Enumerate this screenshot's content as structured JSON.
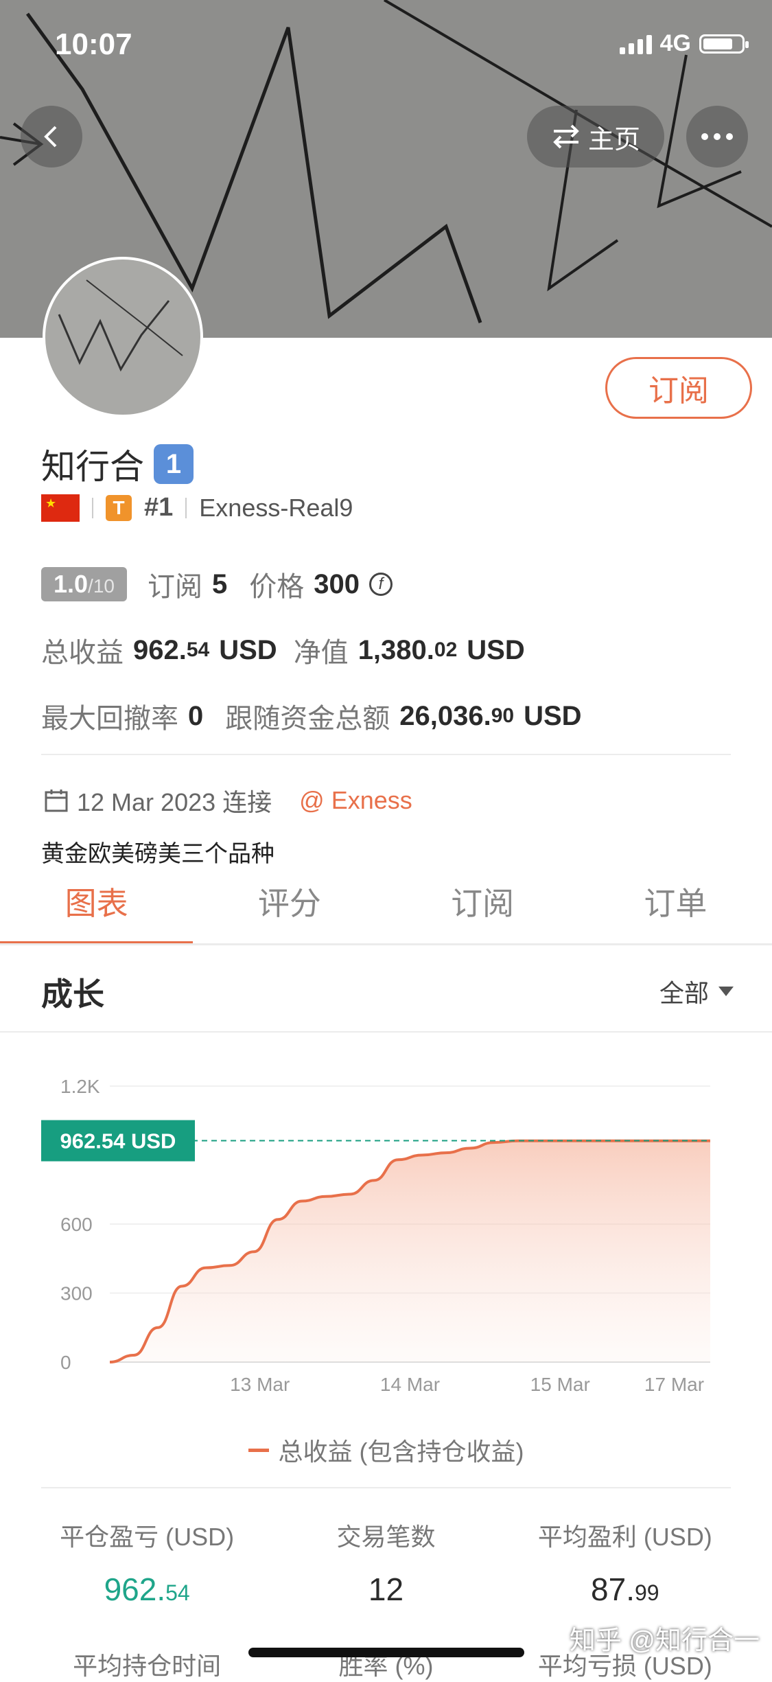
{
  "status": {
    "time": "10:07",
    "network": "4G"
  },
  "header": {
    "back_icon": "chevron-left-icon",
    "home_label": "主页",
    "home_icon": "swap-icon",
    "more_icon": "more-dots-icon"
  },
  "profile": {
    "name": "知行合",
    "badge": "1",
    "rank": "#1",
    "account": "Exness-Real9",
    "subscribe_label": "订阅",
    "score": "1.0",
    "score_max": "/10",
    "subscribe_text": "订阅",
    "subscribe_count": "5",
    "price_label": "价格",
    "price_value": "300",
    "total_profit_label": "总收益",
    "total_profit_int": "962.",
    "total_profit_dec": "54",
    "total_profit_unit": "USD",
    "equity_label": "净值",
    "equity_int": "1,380.",
    "equity_dec": "02",
    "equity_unit": "USD",
    "drawdown_label": "最大回撤率",
    "drawdown_value": "0",
    "follow_label": "跟随资金总额",
    "follow_int": "26,036.",
    "follow_dec": "90",
    "follow_unit": "USD",
    "date_text": "12 Mar 2023 连接",
    "broker": "@ Exness",
    "description": "黄金欧美磅美三个品种"
  },
  "tabs": [
    "图表",
    "评分",
    "订阅",
    "订单"
  ],
  "section": {
    "title": "成长",
    "filter": "全部"
  },
  "chart_data": {
    "type": "area",
    "ylim": [
      0,
      1200
    ],
    "yticks": [
      "0",
      "300",
      "600",
      "1.2K"
    ],
    "ytick_values": [
      0,
      300,
      600,
      1200
    ],
    "xticks": [
      "13 Mar",
      "14 Mar",
      "15 Mar",
      "17 Mar"
    ],
    "xtick_values": [
      0.25,
      0.5,
      0.75,
      0.94
    ],
    "current_label": "962.54 USD",
    "current_value": 962.54,
    "x": [
      0.0,
      0.04,
      0.08,
      0.12,
      0.16,
      0.2,
      0.24,
      0.28,
      0.32,
      0.36,
      0.4,
      0.44,
      0.48,
      0.52,
      0.56,
      0.6,
      0.64,
      0.68,
      0.72,
      0.76,
      0.8,
      0.84,
      0.88,
      0.92,
      0.96,
      1.0
    ],
    "values": [
      0,
      30,
      150,
      330,
      410,
      420,
      480,
      620,
      700,
      720,
      730,
      790,
      880,
      900,
      910,
      930,
      955,
      962,
      962,
      962,
      962,
      962,
      962,
      962,
      962,
      962
    ],
    "legend": "总收益 (包含持仓收益)",
    "color": "#e8704a"
  },
  "stats": [
    {
      "label": "平仓盈亏 (USD)",
      "int": "962.",
      "dec": "54",
      "color": "green"
    },
    {
      "label": "交易笔数",
      "int": "12",
      "dec": "",
      "color": ""
    },
    {
      "label": "平均盈利 (USD)",
      "int": "87.",
      "dec": "99",
      "color": ""
    }
  ],
  "stats2": [
    "平均持仓时间",
    "胜率 (%)",
    "平均亏损 (USD)"
  ],
  "watermark": "知乎 @知行合一",
  "colors": {
    "accent": "#e8704a",
    "green": "#1fa58a",
    "teal_label": "#179e80"
  }
}
